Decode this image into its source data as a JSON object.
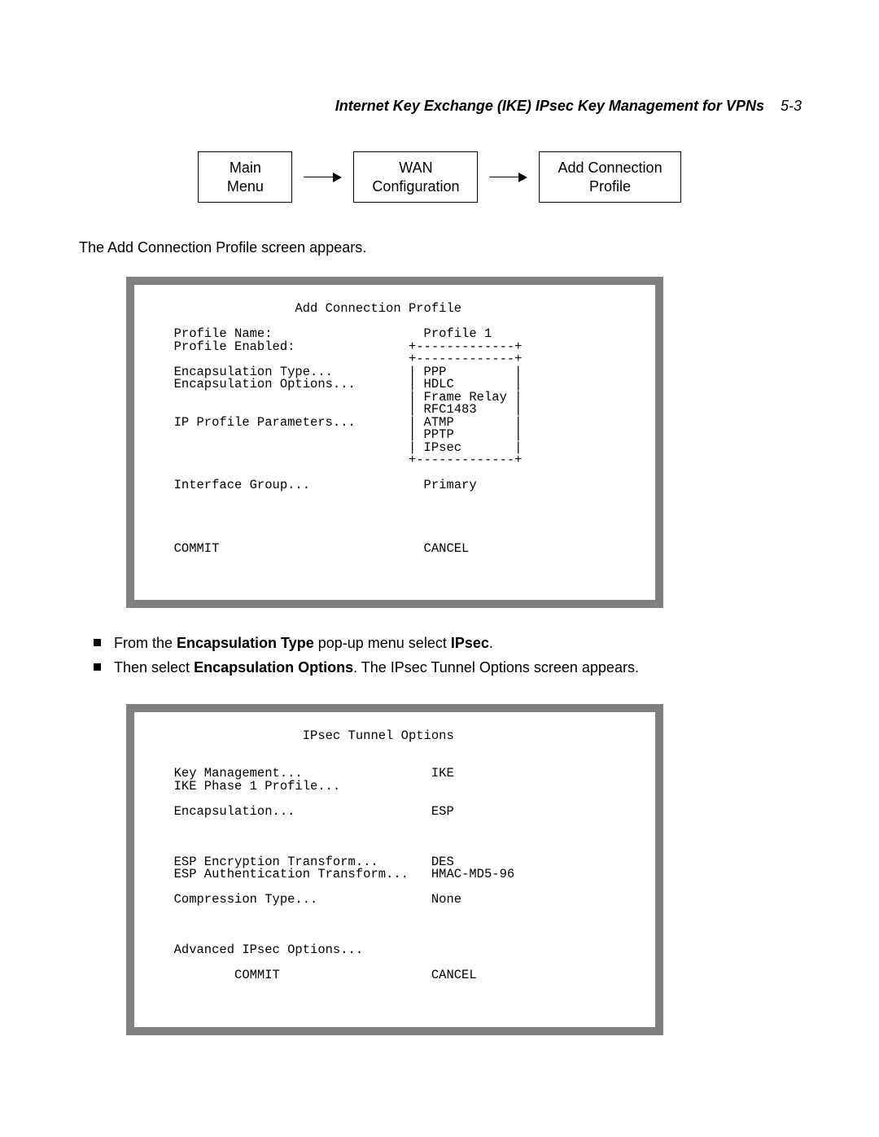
{
  "header": {
    "title": "Internet Key Exchange (IKE) IPsec Key Management for VPNs",
    "pagenum": "5-3"
  },
  "flow": {
    "b1_l1": "Main",
    "b1_l2": "Menu",
    "b2_l1": "WAN",
    "b2_l2": "Configuration",
    "b3_l1": "Add Connection",
    "b3_l2": "Profile"
  },
  "intro": "The Add Connection Profile screen appears.",
  "panel1": "                  Add Connection Profile\n\n  Profile Name:                    Profile 1\n  Profile Enabled:               +-------------+\n                                 +-------------+\n  Encapsulation Type...          | PPP         |\n  Encapsulation Options...       | HDLC        |\n                                 | Frame Relay |\n                                 | RFC1483     |\n  IP Profile Parameters...       | ATMP        |\n                                 | PPTP        |\n                                 | IPsec       |\n                                 +-------------+\n\n  Interface Group...               Primary\n\n\n\n\n  COMMIT                           CANCEL",
  "bullets": {
    "b1_pre": "From the ",
    "b1_strong1": "Encapsulation Type",
    "b1_mid": " pop-up menu select ",
    "b1_strong2": "IPsec",
    "b1_post": ".",
    "b2_pre": "Then select ",
    "b2_strong1": "Encapsulation Options",
    "b2_post": ". The IPsec Tunnel Options screen appears."
  },
  "panel2": "                   IPsec Tunnel Options\n\n\n  Key Management...                 IKE\n  IKE Phase 1 Profile...\n\n  Encapsulation...                  ESP\n\n\n\n  ESP Encryption Transform...       DES\n  ESP Authentication Transform...   HMAC-MD5-96\n\n  Compression Type...               None\n\n\n\n  Advanced IPsec Options...\n\n          COMMIT                    CANCEL"
}
